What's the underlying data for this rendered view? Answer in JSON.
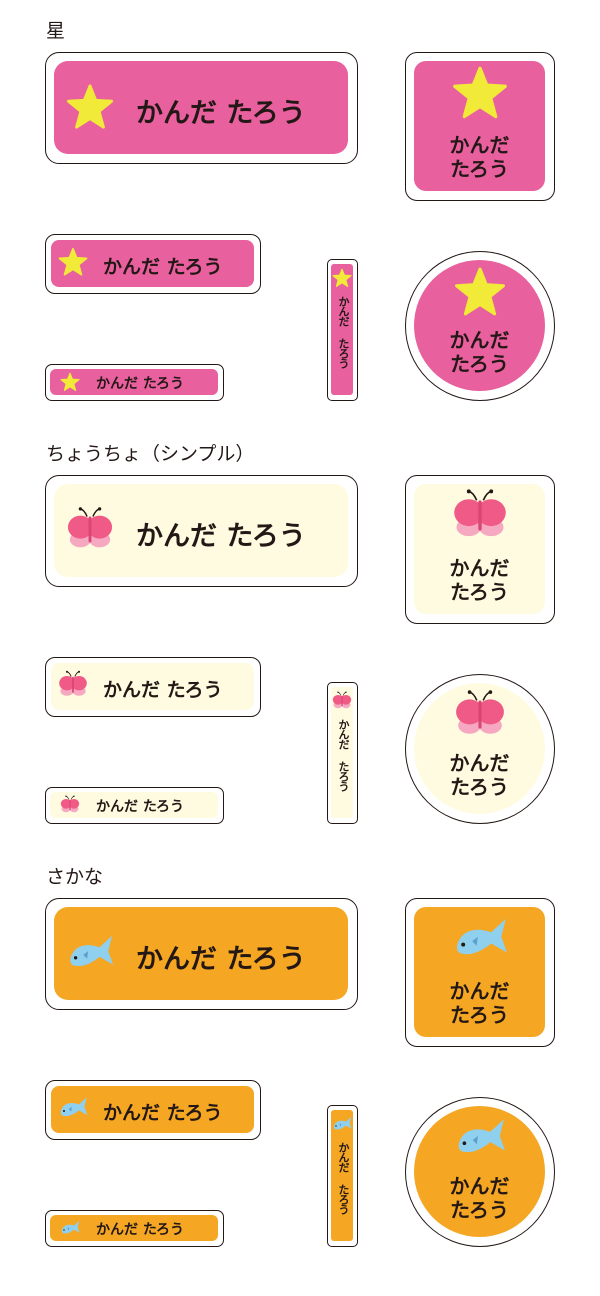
{
  "sections": [
    {
      "title": "星",
      "icon": "star-icon",
      "fill": "#e8609e"
    },
    {
      "title": "ちょうちょ（シンプル）",
      "icon": "butterfly-icon",
      "fill": "#fffbe0"
    },
    {
      "title": "さかな",
      "icon": "fish-icon",
      "fill": "#f5a623"
    }
  ],
  "label_name": "かんだ たろう",
  "label_name_line1": "かんだ",
  "label_name_line2": "たろう",
  "label_name_vertical": "かんだ たろう",
  "colors": {
    "star_pink": "#e8609e",
    "star_yellow": "#f2ea38",
    "butterfly_cream": "#fffbe0",
    "butterfly_pink": "#ef5b86",
    "butterfly_light_pink": "#f7a8c1",
    "fish_orange": "#f5a623",
    "fish_blue": "#8fd0ee",
    "outline": "#231815"
  }
}
